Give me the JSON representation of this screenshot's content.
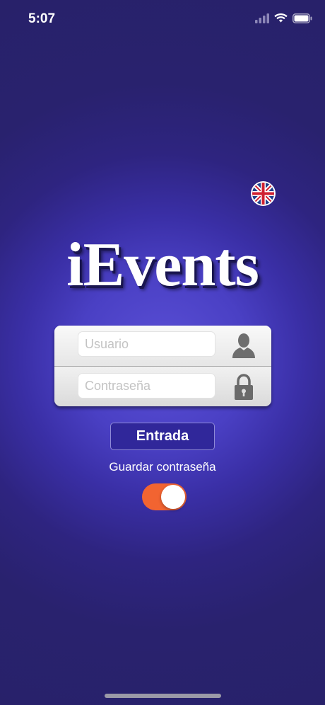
{
  "status_bar": {
    "time": "5:07",
    "icons": [
      "cellular-signal-icon",
      "wifi-icon",
      "battery-icon"
    ]
  },
  "language": {
    "icon": "uk-flag-icon"
  },
  "app": {
    "logo_text": "iEvents"
  },
  "login_form": {
    "username_placeholder": "Usuario",
    "username_value": "",
    "username_icon": "user-silhouette-icon",
    "password_placeholder": "Contraseña",
    "password_value": "",
    "password_icon": "padlock-icon"
  },
  "actions": {
    "login_label": "Entrada",
    "save_password_label": "Guardar contraseña",
    "save_password_enabled": true
  },
  "colors": {
    "background": "#28216a",
    "glow": "#5a4fd6",
    "button": "#30279a",
    "toggle_on": "#f26431"
  }
}
